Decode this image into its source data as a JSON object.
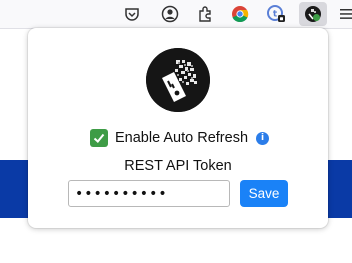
{
  "toolbar": {
    "icons": [
      "pocket-icon",
      "account-icon",
      "extensions-icon",
      "chrome-icon",
      "extension-badge-icon",
      "active-extension-icon",
      "menu-icon"
    ]
  },
  "popup": {
    "auto_refresh_label": "Enable Auto Refresh",
    "auto_refresh_checked": true,
    "info_glyph": "i",
    "token_label": "REST API Token",
    "token_value": "••••••••••",
    "save_label": "Save"
  },
  "colors": {
    "checkbox": "#3e9c46",
    "info": "#2b7de9",
    "save_button": "#1a82f7",
    "page_band": "#0a3aa6"
  }
}
